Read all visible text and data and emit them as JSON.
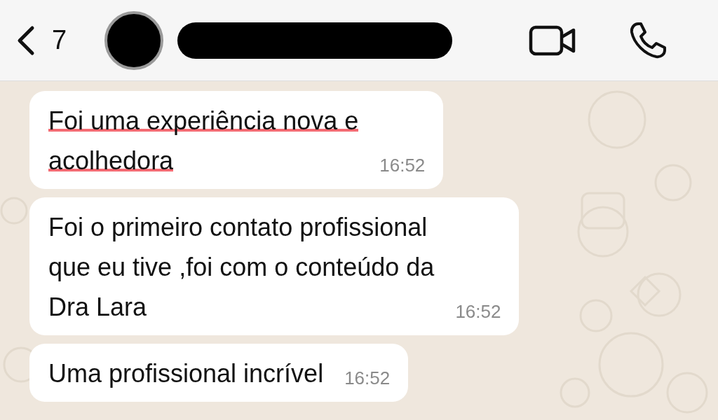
{
  "header": {
    "back_count": "7"
  },
  "messages": [
    {
      "lines": [
        "Foi uma experiência nova e",
        "acolhedora"
      ],
      "time": "16:52",
      "underlined": true
    },
    {
      "lines": [
        "Foi o primeiro contato profissional",
        "que eu tive ,foi com o conteúdo da",
        "Dra Lara"
      ],
      "time": "16:52",
      "underlined": false
    },
    {
      "lines": [
        "Uma profissional incrível"
      ],
      "time": "16:52",
      "underlined": false
    }
  ]
}
